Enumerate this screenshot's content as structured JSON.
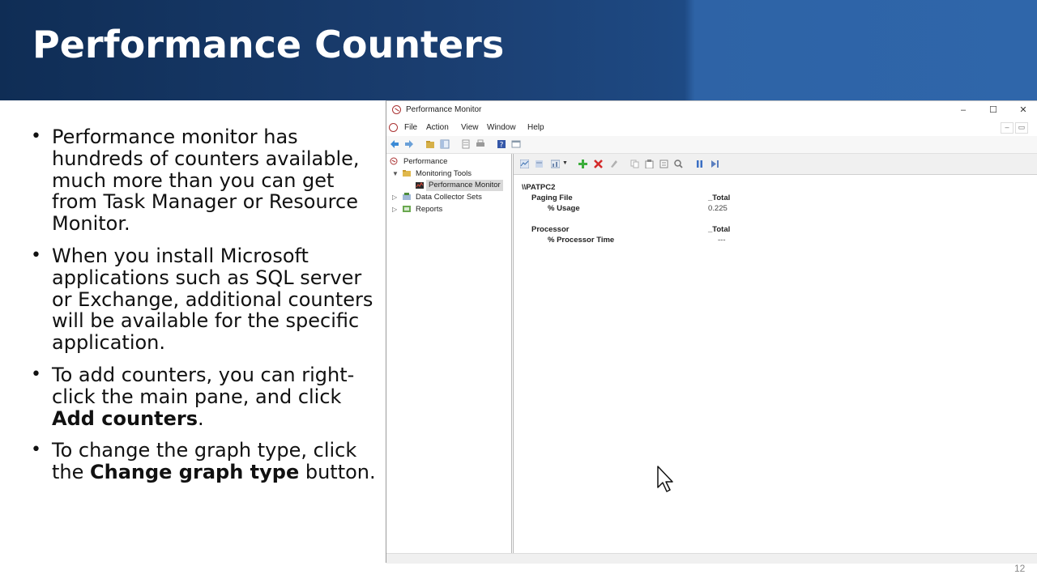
{
  "slide": {
    "title": "Performance Counters",
    "page_number": "12"
  },
  "bullets": [
    {
      "text": "Performance monitor has hundreds of counters available, much more than you can get from Task Manager or Resource Monitor."
    },
    {
      "text": "When you install Microsoft applications such as SQL server or Exchange, additional counters will be available for the specific application."
    },
    {
      "prefix": "To add counters, you can right-click the main pane, and click ",
      "bold": "Add counters",
      "suffix": "."
    },
    {
      "prefix": "To change the graph type, click the ",
      "bold": "Change graph type",
      "suffix": " button."
    }
  ],
  "window": {
    "title": "Performance Monitor",
    "controls": {
      "minimize": "–",
      "maximize": "☐",
      "close": "✕"
    },
    "menu": [
      "File",
      "Action",
      "View",
      "Window",
      "Help"
    ],
    "mdi_controls": {
      "minimize": "–",
      "restore": "▭"
    },
    "tree": {
      "root": "Performance",
      "monitoring_tools": "Monitoring Tools",
      "performance_monitor": "Performance Monitor",
      "data_collector_sets": "Data Collector Sets",
      "reports": "Reports"
    },
    "report": {
      "computer": "\\\\PATPC2",
      "objects": [
        {
          "name": "Paging File",
          "instance": "_Total",
          "counter": "% Usage",
          "value": "0.225"
        },
        {
          "name": "Processor",
          "instance": "_Total",
          "counter": "% Processor Time",
          "value": "---"
        }
      ]
    }
  },
  "colors": {
    "header_dark": "#0f2d55",
    "header_light": "#2f66aa",
    "add_icon": "#3cae3c",
    "delete_icon": "#d42a2a",
    "pause_icon": "#3b6fc4"
  },
  "icons": {
    "app": "perfmon-icon",
    "back": "back-arrow-icon",
    "forward": "forward-arrow-icon",
    "add": "add-counter-icon",
    "delete": "delete-counter-icon",
    "pause": "freeze-display-icon"
  }
}
